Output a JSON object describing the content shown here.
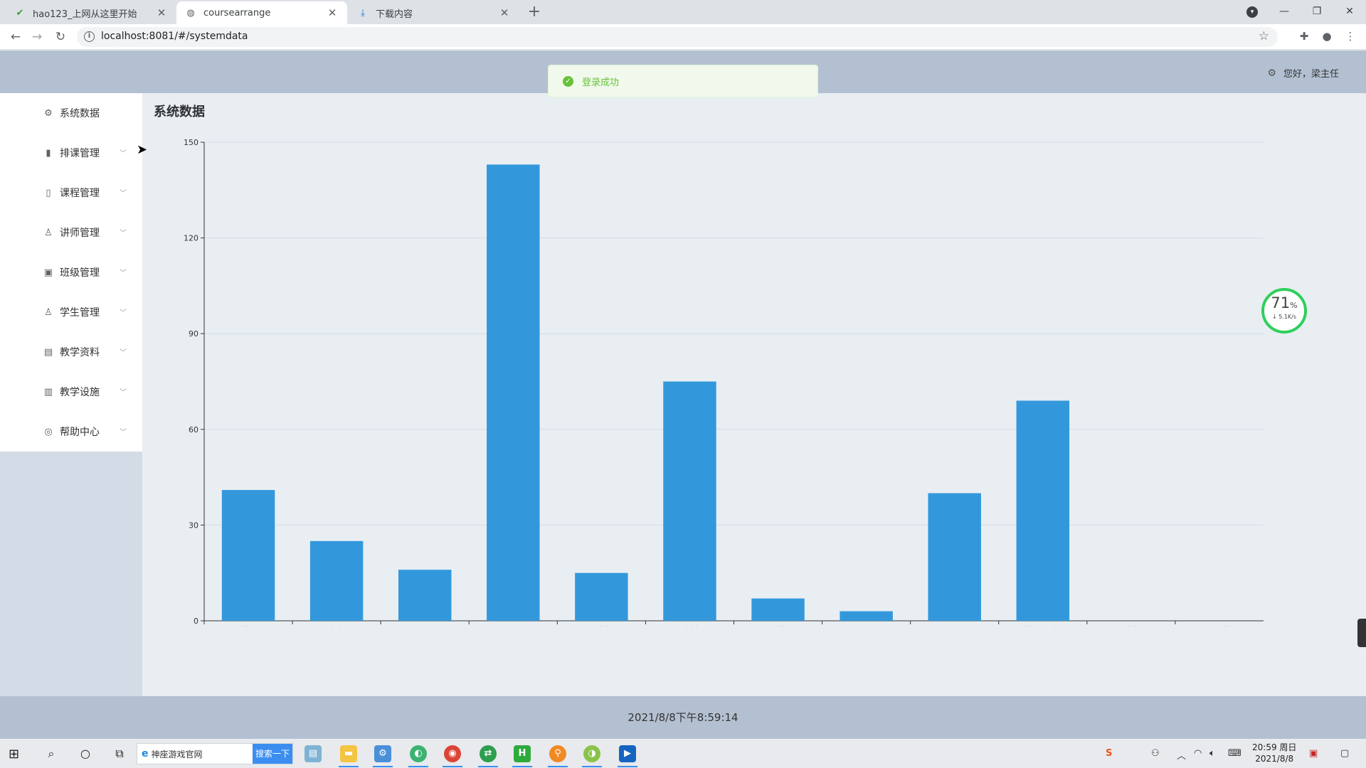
{
  "browser": {
    "tabs": [
      {
        "title": "hao123_上网从这里开始",
        "icon": "hao123-icon"
      },
      {
        "title": "coursearrange",
        "icon": "globe-icon"
      },
      {
        "title": "下载内容",
        "icon": "download-icon"
      }
    ],
    "url": "localhost:8081/#/systemdata"
  },
  "header": {
    "greeting": "您好，梁主任"
  },
  "toast": {
    "message": "登录成功"
  },
  "sidebar": {
    "items": [
      {
        "label": "系统数据",
        "icon": "gear-icon",
        "glyph": "⚙"
      },
      {
        "label": "排课管理",
        "icon": "bar-chart-icon",
        "glyph": "▮"
      },
      {
        "label": "课程管理",
        "icon": "book-icon",
        "glyph": "▯"
      },
      {
        "label": "讲师管理",
        "icon": "user-icon",
        "glyph": "♙"
      },
      {
        "label": "班级管理",
        "icon": "briefcase-icon",
        "glyph": "▣"
      },
      {
        "label": "学生管理",
        "icon": "user-icon",
        "glyph": "♙"
      },
      {
        "label": "教学资料",
        "icon": "notebook-icon",
        "glyph": "▤"
      },
      {
        "label": "教学设施",
        "icon": "building-icon",
        "glyph": "▥"
      },
      {
        "label": "帮助中心",
        "icon": "help-icon",
        "glyph": "◎"
      }
    ]
  },
  "main": {
    "title": "系统数据"
  },
  "chart_data": {
    "type": "bar",
    "categories": [
      "讲师",
      "学生",
      "班级",
      "教室",
      "教学楼",
      "教材",
      "文档",
      "网课",
      "题库",
      "排课任务",
      "新增学生",
      "新增讲师"
    ],
    "values": [
      41,
      25,
      16,
      143,
      15,
      75,
      7,
      3,
      40,
      69,
      0,
      0
    ],
    "ylim": [
      0,
      150
    ],
    "yticks": [
      0,
      30,
      60,
      90,
      120,
      150
    ],
    "grid": true,
    "color": "#3398db"
  },
  "speed_widget": {
    "percent": "71",
    "unit": "%",
    "rate": "5.1K/s"
  },
  "footer": {
    "datetime": "2021/8/8下午8:59:14"
  },
  "taskbar": {
    "search_text": "神座游戏官网",
    "search_button": "搜索一下",
    "time": "20:59 周日",
    "date": "2021/8/8"
  }
}
